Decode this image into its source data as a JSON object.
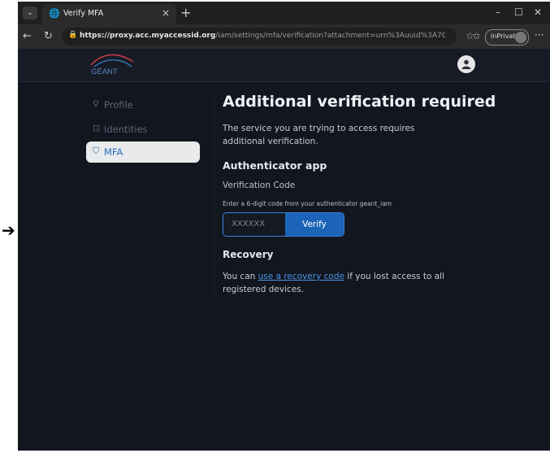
{
  "browser": {
    "tab_title": "Verify MFA",
    "url_host": "https://proxy.acc.myaccessid.org",
    "url_path": "/iam/settings/mfa/verification?attachment=urn%3Auuid%3A7013fbcb...",
    "inprivate_label": "InPrivate"
  },
  "header": {
    "logo_text": "GÉANT"
  },
  "sidebar": {
    "items": [
      {
        "label": "Profile",
        "icon": "person-icon",
        "active": false
      },
      {
        "label": "Identities",
        "icon": "lock-icon",
        "active": false
      },
      {
        "label": "MFA",
        "icon": "shield-icon",
        "active": true
      }
    ]
  },
  "main": {
    "title": "Additional verification required",
    "description": "The service you are trying to access requires additional verification.",
    "authenticator_heading": "Authenticator app",
    "code_label": "Verification Code",
    "code_hint": "Enter a 6-digit code from your authenticator geant_iam",
    "code_placeholder": "XXXXXX",
    "verify_label": "Verify",
    "recovery_heading": "Recovery",
    "recovery_prefix": "You can ",
    "recovery_link": "use a recovery code",
    "recovery_suffix": " if you lost access to all registered devices."
  },
  "colors": {
    "page_bg": "#12161f",
    "accent": "#1b64b8",
    "link": "#4a96e8"
  }
}
